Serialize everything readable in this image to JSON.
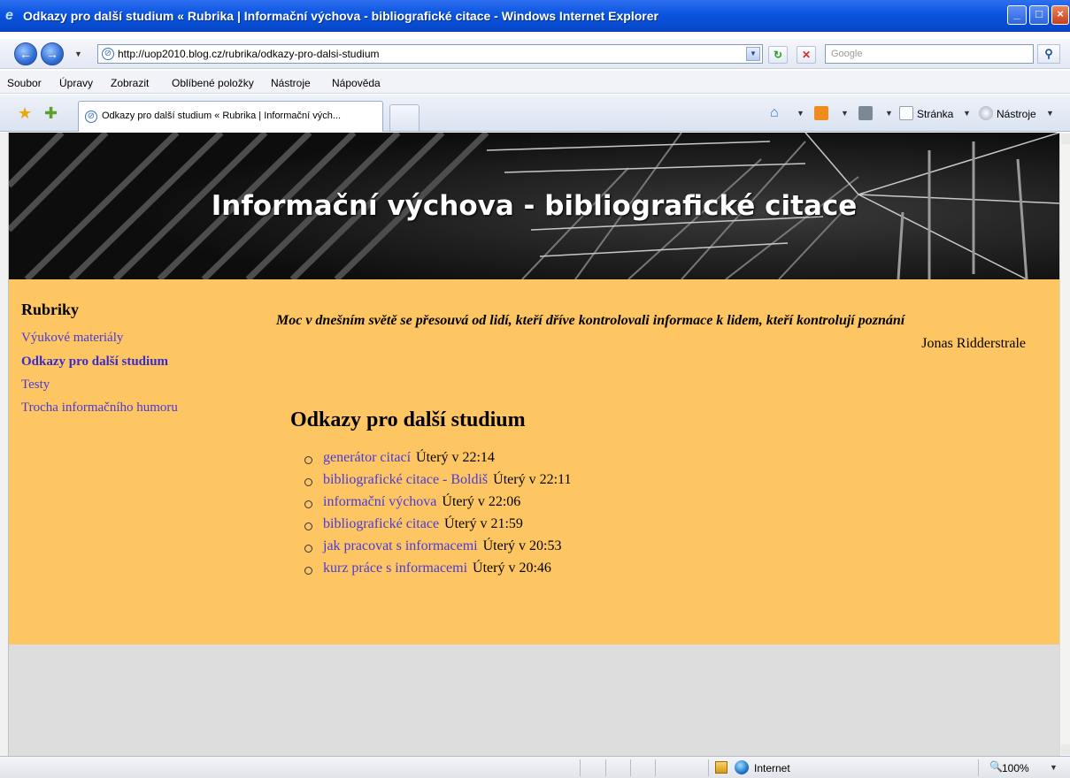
{
  "window": {
    "title": "Odkazy pro další studium « Rubrika | Informační výchova - bibliografické citace - Windows Internet Explorer"
  },
  "address_bar": {
    "url": "http://uop2010.blog.cz/rubrika/odkazy-pro-dalsi-studium",
    "search_placeholder": "Google"
  },
  "menu": {
    "items": [
      "Soubor",
      "Úpravy",
      "Zobrazit",
      "Oblíbené položky",
      "Nástroje",
      "Nápověda"
    ]
  },
  "tabs": [
    {
      "label": "Odkazy pro další studium « Rubrika | Informační vých..."
    }
  ],
  "command_bar": {
    "page_label": "Stránka",
    "tools_label": "Nástroje"
  },
  "page": {
    "site_title": "Informační výchova - bibliografické citace",
    "sidebar": {
      "title": "Rubriky",
      "items": [
        {
          "label": "Výukové materiály",
          "active": false
        },
        {
          "label": "Odkazy pro další studium",
          "active": true
        },
        {
          "label": "Testy",
          "active": false
        },
        {
          "label": "Trocha informačního humoru",
          "active": false
        }
      ]
    },
    "quote": {
      "text": "Moc v dnešním světě se přesouvá od lidí, kteří dříve kontrolovali informace k lidem, kteří kontrolují poznání",
      "author": "Jonas Ridderstrale"
    },
    "section_title": "Odkazy pro další studium",
    "links": [
      {
        "label": "generátor citací",
        "time": "Úterý v 22:14"
      },
      {
        "label": "bibliografické citace - Boldiš",
        "time": "Úterý v 22:11"
      },
      {
        "label": "informační výchova",
        "time": "Úterý v 22:06"
      },
      {
        "label": "bibliografické citace",
        "time": "Úterý v 21:59"
      },
      {
        "label": "jak pracovat s informacemi",
        "time": "Úterý v 20:53"
      },
      {
        "label": "kurz práce s informacemi",
        "time": "Úterý v 20:46"
      }
    ]
  },
  "status_bar": {
    "zone": "Internet",
    "zoom": "100%"
  },
  "colors": {
    "content_background": "#fdc663",
    "link": "#4a3ad6",
    "page_background": "#dddddd"
  }
}
